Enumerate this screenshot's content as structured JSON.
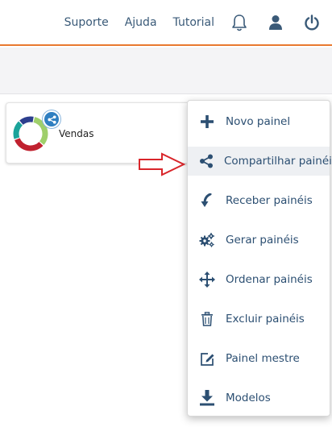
{
  "header": {
    "links": [
      "Suporte",
      "Ajuda",
      "Tutorial"
    ],
    "icons": [
      "bell-icon",
      "user-icon",
      "power-icon"
    ]
  },
  "card": {
    "title": "Vendas",
    "badge_icon": "share-icon",
    "donut_colors": [
      "#c0212f",
      "#9fcf6b",
      "#1aa39a",
      "#2d3f8e"
    ]
  },
  "colors": {
    "accent": "#e8792f",
    "menu_text": "#2c4f72",
    "arrow": "#d9262b",
    "badge": "#2f7fc1"
  },
  "menu": {
    "items": [
      {
        "label": "Novo painel",
        "icon": "plus-icon"
      },
      {
        "label": "Compartilhar painéis",
        "icon": "share-icon"
      },
      {
        "label": "Receber painéis",
        "icon": "receive-arrow-icon"
      },
      {
        "label": "Gerar painéis",
        "icon": "gears-icon"
      },
      {
        "label": "Ordenar painéis",
        "icon": "move-arrows-icon"
      },
      {
        "label": "Excluir painéis",
        "icon": "trash-icon"
      },
      {
        "label": "Painel mestre",
        "icon": "edit-icon"
      },
      {
        "label": "Modelos",
        "icon": "download-icon"
      }
    ],
    "active_index": 1
  }
}
